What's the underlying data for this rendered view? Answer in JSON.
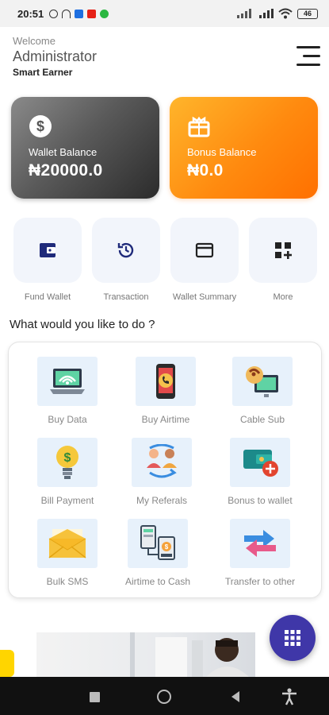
{
  "status": {
    "time": "20:51",
    "battery": "46"
  },
  "header": {
    "welcome": "Welcome",
    "user_name": "Administrator",
    "app_name": "Smart Earner"
  },
  "balances": {
    "wallet": {
      "label": "Wallet Balance",
      "amount": "₦20000.0"
    },
    "bonus": {
      "label": "Bonus Balance",
      "amount": "₦0.0"
    }
  },
  "quick_actions": [
    {
      "label": "Fund Wallet",
      "icon": "wallet-icon"
    },
    {
      "label": "Transaction",
      "icon": "history-icon"
    },
    {
      "label": "Wallet Summary",
      "icon": "card-icon"
    },
    {
      "label": "More",
      "icon": "grid-plus-icon"
    }
  ],
  "section_title": "What would you like to do ?",
  "services": [
    {
      "label": "Buy Data",
      "icon": "laptop-wifi-icon"
    },
    {
      "label": "Buy Airtime",
      "icon": "phone-call-icon"
    },
    {
      "label": "Cable Sub",
      "icon": "satellite-tv-icon"
    },
    {
      "label": "Bill Payment",
      "icon": "lightbulb-dollar-icon"
    },
    {
      "label": "My Referals",
      "icon": "referral-users-icon"
    },
    {
      "label": "Bonus to wallet",
      "icon": "wallet-transfer-icon"
    },
    {
      "label": "Bulk SMS",
      "icon": "envelope-icon"
    },
    {
      "label": "Airtime to Cash",
      "icon": "phone-to-cash-icon"
    },
    {
      "label": "Transfer to other",
      "icon": "transfer-arrows-icon"
    }
  ],
  "colors": {
    "accent": "#3f37a8",
    "bonus_orange": "#ff8a0f",
    "wallet_dark": "#3a3a3a",
    "icon_navy": "#1f2a7a"
  }
}
